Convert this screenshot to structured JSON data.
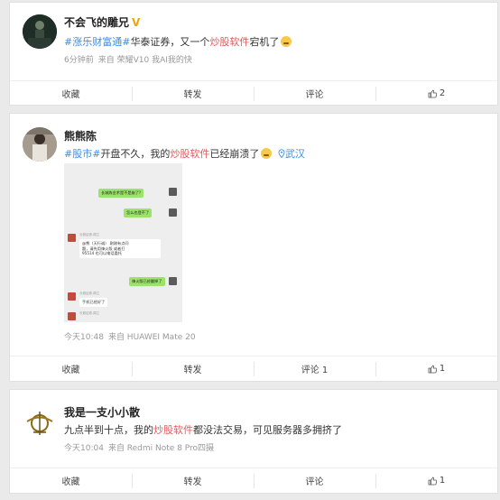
{
  "posts": [
    {
      "username": "不会飞的雕兄",
      "content": {
        "topic": "#涨乐财富通#",
        "text1": "华泰证券，又一个",
        "highlight": "炒股软件",
        "text2": "宕机了"
      },
      "meta": {
        "time": "6分钟前",
        "source": "来自 荣耀V10 我AI我的快"
      },
      "actions": {
        "collect": "收藏",
        "forward": "转发",
        "comment": "评论",
        "like": "2"
      }
    },
    {
      "username": "熊熊陈",
      "content": {
        "topic": "#股市#",
        "text1": "开盘不久，我的",
        "highlight": "炒股软件",
        "text2": "已经崩溃了",
        "location": "武汉"
      },
      "screenshot": {
        "msg1": "长城炼金术是不是崩了?",
        "msg2": "怎么也登不了",
        "msg3_name": "长城证券-周立",
        "msg3_line1": "@熊（天行诚）  刚刚有点问",
        "msg3_line2": "题，请先用烽火版 或者打",
        "msg3_line3": "95514 也可以电话委托",
        "msg4": "烽火版已经翻掉了",
        "msg5_name": "长城证券-周立",
        "msg5": "手机已经好了",
        "msg6_name": "长城证券-周立"
      },
      "meta": {
        "time": "今天10:48",
        "source": "来自 HUAWEI Mate 20"
      },
      "actions": {
        "collect": "收藏",
        "forward": "转发",
        "comment": "评论 1",
        "like": "1"
      }
    },
    {
      "username": "我是一支小小散",
      "content": {
        "text1": "九点半到十点，我的",
        "highlight": "炒股软件",
        "text2": "都没法交易，可见服务器多拥挤了"
      },
      "meta": {
        "time": "今天10:04",
        "source": "来自 Redmi Note 8 Pro四摄"
      },
      "actions": {
        "collect": "收藏",
        "forward": "转发",
        "comment": "评论",
        "like": "1"
      }
    }
  ]
}
